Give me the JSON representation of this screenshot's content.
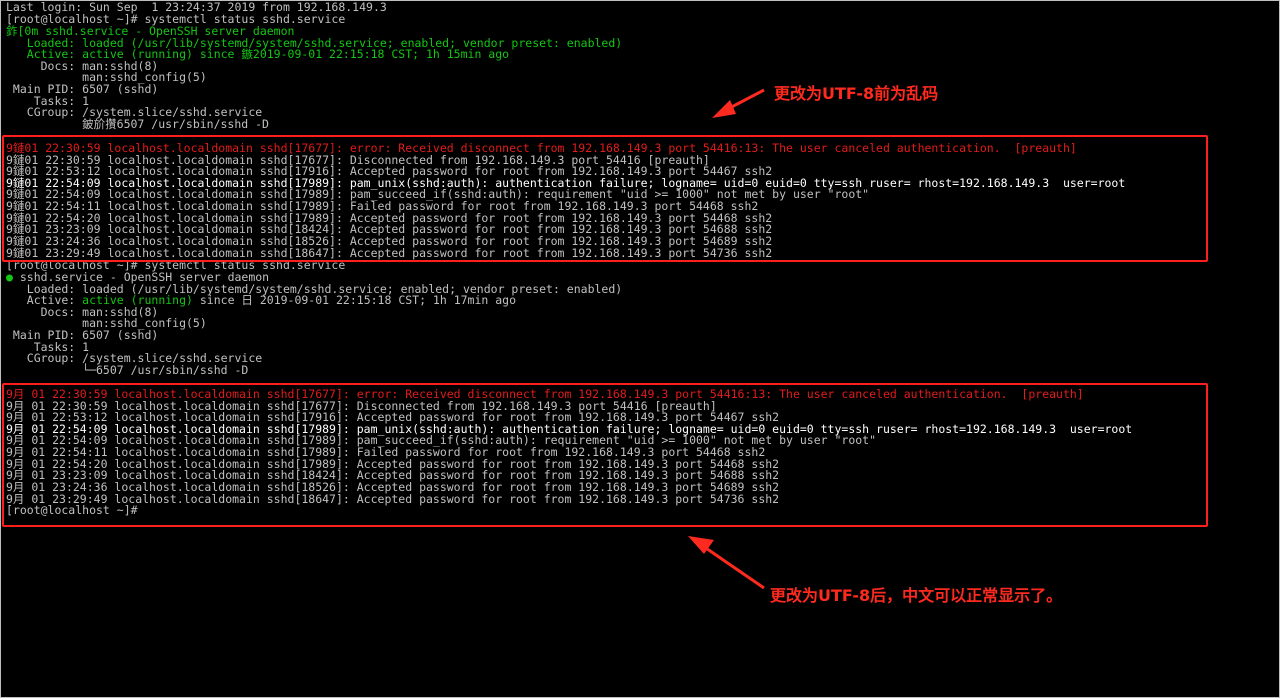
{
  "pre_utf8": {
    "lines": [
      "Last login: Sun Sep  1 23:24:37 2019 from 192.168.149.3",
      "[root@localhost ~]# systemctl status sshd.service",
      "鈼[0m sshd.service - OpenSSH server daemon",
      "   Loaded: loaded (/usr/lib/systemd/system/sshd.service; enabled; vendor preset: enabled)",
      "   Active: active (running) since 鏃2019-09-01 22:15:18 CST; 1h 15min ago",
      "     Docs: man:sshd(8)",
      "           man:sshd_config(5)",
      " Main PID: 6507 (sshd)",
      "    Tasks: 1",
      "   CGroup: /system.slice/sshd.service",
      "           鈹斺攢6507 /usr/sbin/sshd -D"
    ],
    "log": [
      "9鏈01 22:30:59 localhost.localdomain sshd[17677]: error: Received disconnect from 192.168.149.3 port 54416:13: The user canceled authentication.  [preauth]",
      "9鏈01 22:30:59 localhost.localdomain sshd[17677]: Disconnected from 192.168.149.3 port 54416 [preauth]",
      "9鏈01 22:53:12 localhost.localdomain sshd[17916]: Accepted password for root from 192.168.149.3 port 54467 ssh2",
      "9鏈01 22:54:09 localhost.localdomain sshd[17989]: pam_unix(sshd:auth): authentication failure; logname= uid=0 euid=0 tty=ssh ruser= rhost=192.168.149.3  user=root",
      "9鏈01 22:54:09 localhost.localdomain sshd[17989]: pam_succeed_if(sshd:auth): requirement \"uid >= 1000\" not met by user \"root\"",
      "9鏈01 22:54:11 localhost.localdomain sshd[17989]: Failed password for root from 192.168.149.3 port 54468 ssh2",
      "9鏈01 22:54:20 localhost.localdomain sshd[17989]: Accepted password for root from 192.168.149.3 port 54468 ssh2",
      "9鏈01 23:23:09 localhost.localdomain sshd[18424]: Accepted password for root from 192.168.149.3 port 54688 ssh2",
      "9鏈01 23:24:36 localhost.localdomain sshd[18526]: Accepted password for root from 192.168.149.3 port 54689 ssh2",
      "9鏈01 23:29:49 localhost.localdomain sshd[18647]: Accepted password for root from 192.168.149.3 port 54736 ssh2"
    ]
  },
  "post_utf8": {
    "lines": [
      "[root@localhost ~]# systemctl status sshd.service",
      "● sshd.service - OpenSSH server daemon",
      "   Loaded: loaded (/usr/lib/systemd/system/sshd.service; enabled; vendor preset: enabled)",
      "   Active: active (running) since 日 2019-09-01 22:15:18 CST; 1h 17min ago",
      "     Docs: man:sshd(8)",
      "           man:sshd_config(5)",
      " Main PID: 6507 (sshd)",
      "    Tasks: 1",
      "   CGroup: /system.slice/sshd.service",
      "           └─6507 /usr/sbin/sshd -D"
    ],
    "log": [
      "9月 01 22:30:59 localhost.localdomain sshd[17677]: error: Received disconnect from 192.168.149.3 port 54416:13: The user canceled authentication.  [preauth]",
      "9月 01 22:30:59 localhost.localdomain sshd[17677]: Disconnected from 192.168.149.3 port 54416 [preauth]",
      "9月 01 22:53:12 localhost.localdomain sshd[17916]: Accepted password for root from 192.168.149.3 port 54467 ssh2",
      "9月 01 22:54:09 localhost.localdomain sshd[17989]: pam_unix(sshd:auth): authentication failure; logname= uid=0 euid=0 tty=ssh ruser= rhost=192.168.149.3  user=root",
      "9月 01 22:54:09 localhost.localdomain sshd[17989]: pam_succeed_if(sshd:auth): requirement \"uid >= 1000\" not met by user \"root\"",
      "9月 01 22:54:11 localhost.localdomain sshd[17989]: Failed password for root from 192.168.149.3 port 54468 ssh2",
      "9月 01 22:54:20 localhost.localdomain sshd[17989]: Accepted password for root from 192.168.149.3 port 54468 ssh2",
      "9月 01 23:23:09 localhost.localdomain sshd[18424]: Accepted password for root from 192.168.149.3 port 54688 ssh2",
      "9月 01 23:24:36 localhost.localdomain sshd[18526]: Accepted password for root from 192.168.149.3 port 54689 ssh2",
      "9月 01 23:29:49 localhost.localdomain sshd[18647]: Accepted password for root from 192.168.149.3 port 54736 ssh2",
      "[root@localhost ~]#"
    ]
  },
  "annotations": {
    "before": "更改为UTF-8前为乱码",
    "after": "更改为UTF-8后，中文可以正常显示了。"
  },
  "colors": {
    "terminal_bg": "#000000",
    "text": "#c0c0c0",
    "green": "#13c613",
    "error_red": "#e21b1b",
    "highlight_box": "#ff1e1e",
    "annotation": "#ff2a1f"
  }
}
